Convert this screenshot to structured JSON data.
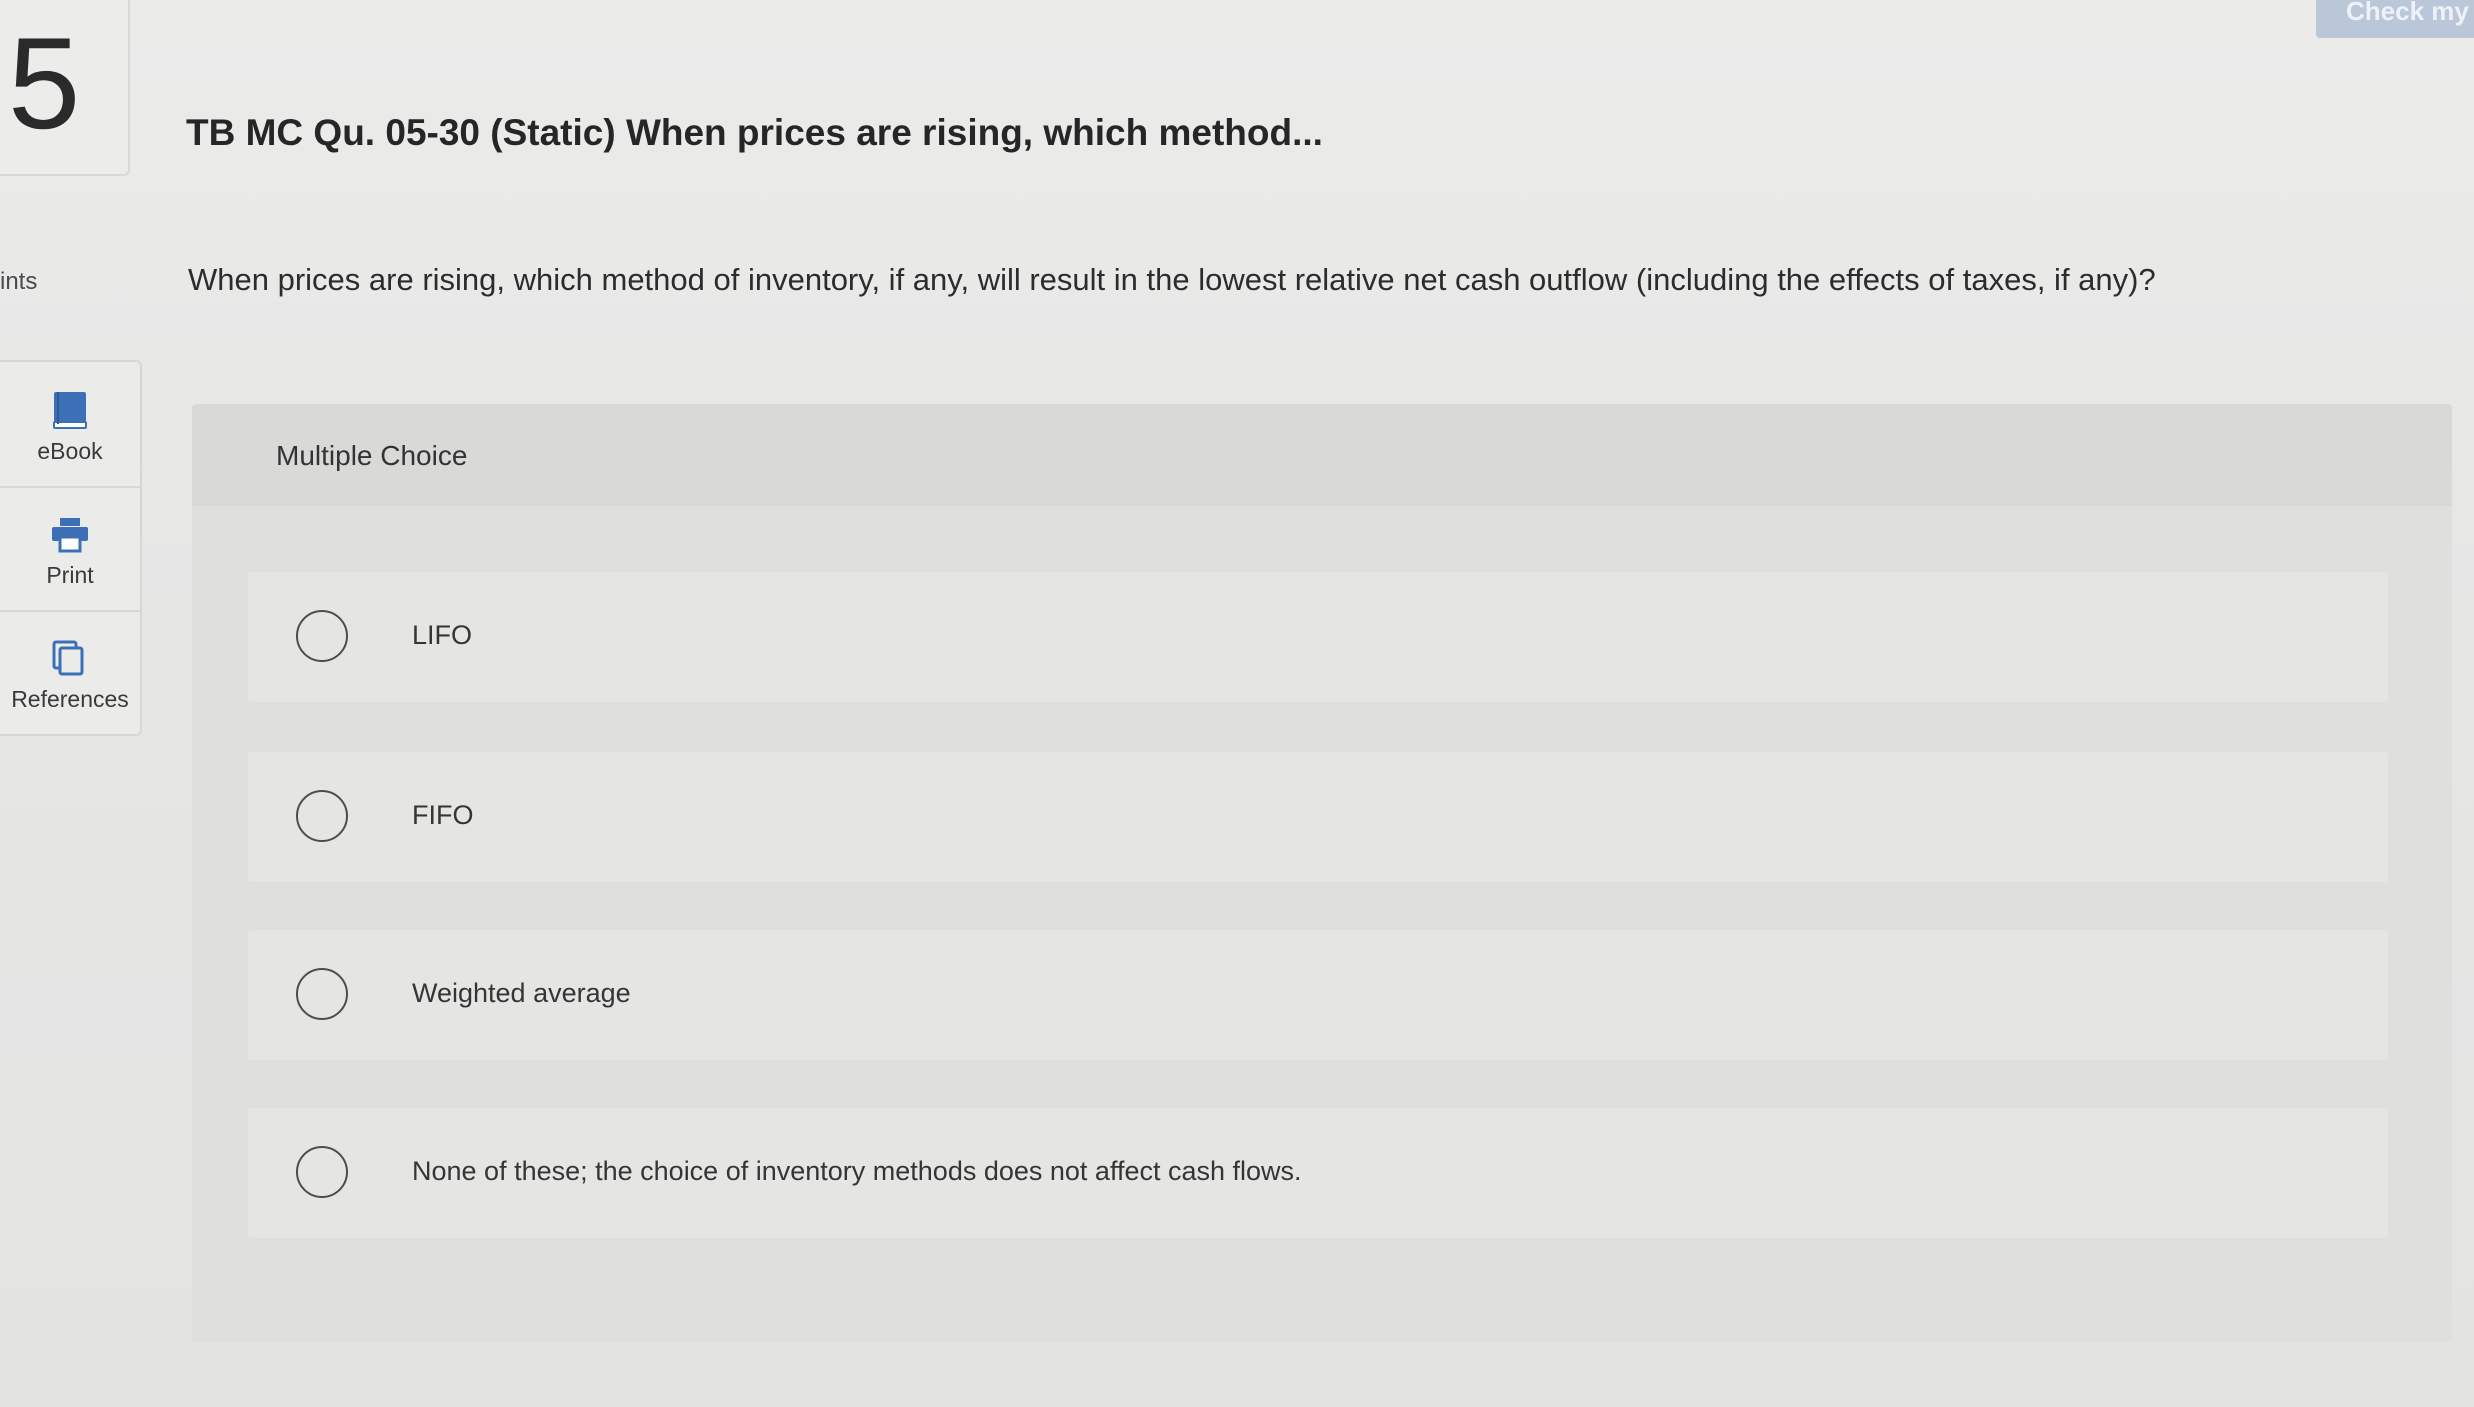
{
  "question": {
    "number": "5",
    "points_label": "ints",
    "title": "TB MC Qu. 05-30 (Static) When prices are rising, which method...",
    "text": "When prices are rising, which method of inventory, if any, will result in the lowest relative net cash outflow (including the effects of taxes, if any)?"
  },
  "header": {
    "check_button_label": "Check my"
  },
  "side_tools": [
    {
      "label": "eBook",
      "icon": "book-icon"
    },
    {
      "label": "Print",
      "icon": "printer-icon"
    },
    {
      "label": "References",
      "icon": "copy-documents-icon"
    }
  ],
  "multiple_choice": {
    "header_label": "Multiple Choice",
    "options": [
      {
        "label": "LIFO",
        "selected": false
      },
      {
        "label": "FIFO",
        "selected": false
      },
      {
        "label": "Weighted average",
        "selected": false
      },
      {
        "label": "None of these; the choice of inventory methods does not affect cash flows.",
        "selected": false
      }
    ]
  },
  "colors": {
    "accent_blue": "#3d6fb6",
    "check_button": "#b9c7d8",
    "panel": "#dfdfde"
  }
}
